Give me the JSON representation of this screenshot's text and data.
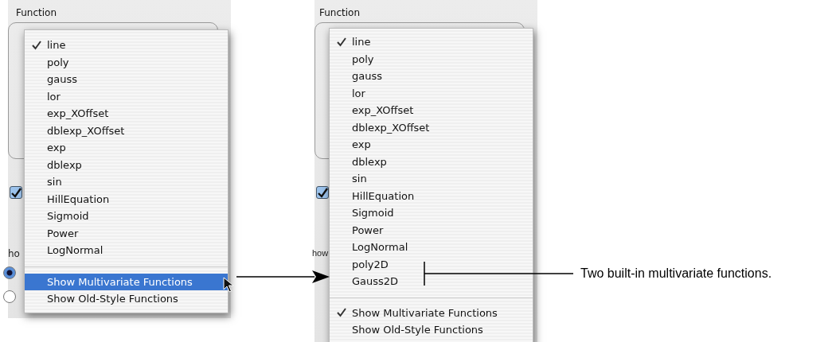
{
  "panels": [
    {
      "title": "Function",
      "use_multiple_processors": {
        "checked": true
      },
      "show_label": "ho",
      "radios": [
        {
          "selected": true
        },
        {
          "selected": false
        }
      ],
      "cursor": true,
      "menu": [
        {
          "kind": "choice",
          "label": "line",
          "checked": true,
          "selected": false
        },
        {
          "kind": "choice",
          "label": "poly",
          "checked": false,
          "selected": false
        },
        {
          "kind": "choice",
          "label": "gauss",
          "checked": false,
          "selected": false
        },
        {
          "kind": "choice",
          "label": "lor",
          "checked": false,
          "selected": false
        },
        {
          "kind": "choice",
          "label": "exp_XOffset",
          "checked": false,
          "selected": false
        },
        {
          "kind": "choice",
          "label": "dblexp_XOffset",
          "checked": false,
          "selected": false
        },
        {
          "kind": "choice",
          "label": "exp",
          "checked": false,
          "selected": false
        },
        {
          "kind": "choice",
          "label": "dblexp",
          "checked": false,
          "selected": false
        },
        {
          "kind": "choice",
          "label": "sin",
          "checked": false,
          "selected": false
        },
        {
          "kind": "choice",
          "label": "HillEquation",
          "checked": false,
          "selected": false
        },
        {
          "kind": "choice",
          "label": "Sigmoid",
          "checked": false,
          "selected": false
        },
        {
          "kind": "choice",
          "label": "Power",
          "checked": false,
          "selected": false
        },
        {
          "kind": "choice",
          "label": "LogNormal",
          "checked": false,
          "selected": false
        },
        {
          "kind": "separator"
        },
        {
          "kind": "toggle",
          "label": "Show Multivariate Functions",
          "checked": false,
          "selected": true
        },
        {
          "kind": "toggle",
          "label": "Show Old-Style Functions",
          "checked": false,
          "selected": false
        }
      ]
    },
    {
      "title": "Function",
      "use_multiple_processors": {
        "checked": true
      },
      "show_label": "how",
      "menu": [
        {
          "kind": "choice",
          "label": "line",
          "checked": true,
          "selected": false
        },
        {
          "kind": "choice",
          "label": "poly",
          "checked": false,
          "selected": false
        },
        {
          "kind": "choice",
          "label": "gauss",
          "checked": false,
          "selected": false
        },
        {
          "kind": "choice",
          "label": "lor",
          "checked": false,
          "selected": false
        },
        {
          "kind": "choice",
          "label": "exp_XOffset",
          "checked": false,
          "selected": false
        },
        {
          "kind": "choice",
          "label": "dblexp_XOffset",
          "checked": false,
          "selected": false
        },
        {
          "kind": "choice",
          "label": "exp",
          "checked": false,
          "selected": false
        },
        {
          "kind": "choice",
          "label": "dblexp",
          "checked": false,
          "selected": false
        },
        {
          "kind": "choice",
          "label": "sin",
          "checked": false,
          "selected": false
        },
        {
          "kind": "choice",
          "label": "HillEquation",
          "checked": false,
          "selected": false
        },
        {
          "kind": "choice",
          "label": "Sigmoid",
          "checked": false,
          "selected": false
        },
        {
          "kind": "choice",
          "label": "Power",
          "checked": false,
          "selected": false
        },
        {
          "kind": "choice",
          "label": "LogNormal",
          "checked": false,
          "selected": false
        },
        {
          "kind": "choice",
          "label": "poly2D",
          "checked": false,
          "selected": false
        },
        {
          "kind": "choice",
          "label": "Gauss2D",
          "checked": false,
          "selected": false
        },
        {
          "kind": "separator"
        },
        {
          "kind": "toggle",
          "label": "Show Multivariate Functions",
          "checked": true,
          "selected": false
        },
        {
          "kind": "toggle",
          "label": "Show Old-Style Functions",
          "checked": false,
          "selected": false
        }
      ]
    }
  ],
  "annotation": "Two built-in multivariate functions."
}
